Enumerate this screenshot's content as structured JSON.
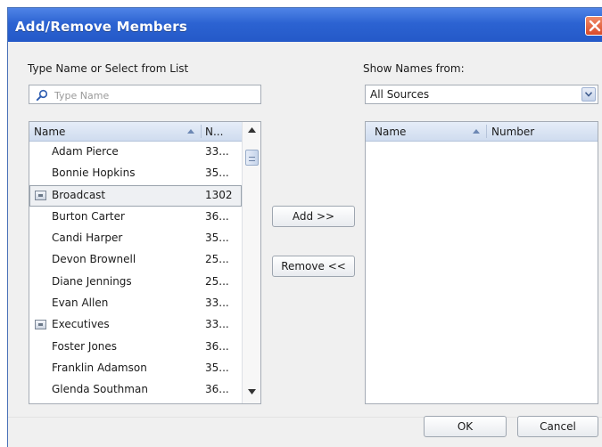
{
  "dialog": {
    "title": "Add/Remove Members"
  },
  "left": {
    "label": "Type Name or Select from List",
    "search_placeholder": "Type Name",
    "columns": {
      "name": "Name",
      "number": "N..."
    },
    "rows": [
      {
        "name": "Adam Pierce",
        "number": "33...",
        "group": false,
        "selected": false
      },
      {
        "name": "Bonnie Hopkins",
        "number": "35...",
        "group": false,
        "selected": false
      },
      {
        "name": "Broadcast",
        "number": "1302",
        "group": true,
        "selected": true
      },
      {
        "name": "Burton Carter",
        "number": "36...",
        "group": false,
        "selected": false
      },
      {
        "name": "Candi Harper",
        "number": "35...",
        "group": false,
        "selected": false
      },
      {
        "name": "Devon Brownell",
        "number": "25...",
        "group": false,
        "selected": false
      },
      {
        "name": "Diane Jennings",
        "number": "25...",
        "group": false,
        "selected": false
      },
      {
        "name": "Evan Allen",
        "number": "33...",
        "group": false,
        "selected": false
      },
      {
        "name": "Executives",
        "number": "33...",
        "group": true,
        "selected": false
      },
      {
        "name": "Foster Jones",
        "number": "36...",
        "group": false,
        "selected": false
      },
      {
        "name": "Franklin Adamson",
        "number": "35...",
        "group": false,
        "selected": false
      },
      {
        "name": "Glenda Southman",
        "number": "36...",
        "group": false,
        "selected": false
      }
    ]
  },
  "right": {
    "label": "Show Names from:",
    "source": "All Sources",
    "columns": {
      "name": "Name",
      "number": "Number"
    }
  },
  "buttons": {
    "add": "Add >>",
    "remove": "Remove <<",
    "ok": "OK",
    "cancel": "Cancel"
  },
  "icons": {
    "search": "search-icon",
    "close": "close-icon",
    "dropdown": "chevron-down-icon",
    "sort": "sort-ascending-icon",
    "group": "group-icon"
  },
  "colors": {
    "titlebar": "#2c63d2",
    "close": "#d94b2a",
    "selection": "#eef0f3"
  }
}
